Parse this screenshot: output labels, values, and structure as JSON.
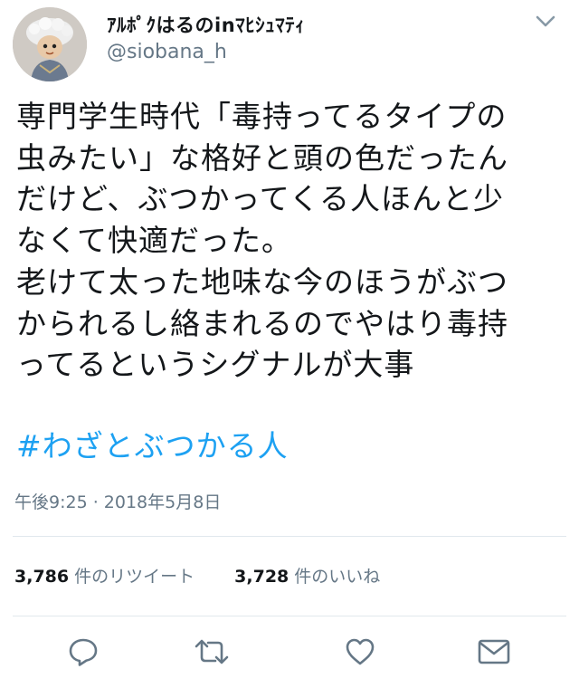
{
  "header": {
    "display_name": "ｱﾙﾎﾟｸはるのinﾏﾋｼｭﾏﾃｨ",
    "handle": "@siobana_h",
    "avatar_icon": "profile-avatar",
    "menu_icon": "chevron-down-icon"
  },
  "tweet": {
    "text": "専門学生時代「毒持ってるタイプの\n虫みたい」な格好と頭の色だったん\nだけど、ぶつかってくる人ほんと少\nなくて快適だった。\n老けて太った地味な今のほうがぶつ\nかられるし絡まれるのでやはり毒持\nってるというシグナルが大事",
    "hashtag": "#わざとぶつかる人",
    "timestamp": "午後9:25 · 2018年5月8日"
  },
  "stats": {
    "retweets_count": "3,786",
    "retweets_label": " 件のリツイート",
    "likes_count": "3,728",
    "likes_label": " 件のいいね"
  },
  "actions": {
    "reply_icon": "reply-icon",
    "retweet_icon": "retweet-icon",
    "like_icon": "heart-icon",
    "dm_icon": "envelope-icon"
  },
  "colors": {
    "text": "#14171a",
    "secondary": "#657786",
    "link": "#1da1f2",
    "divider": "#e1e8ed",
    "icon": "#657786"
  }
}
